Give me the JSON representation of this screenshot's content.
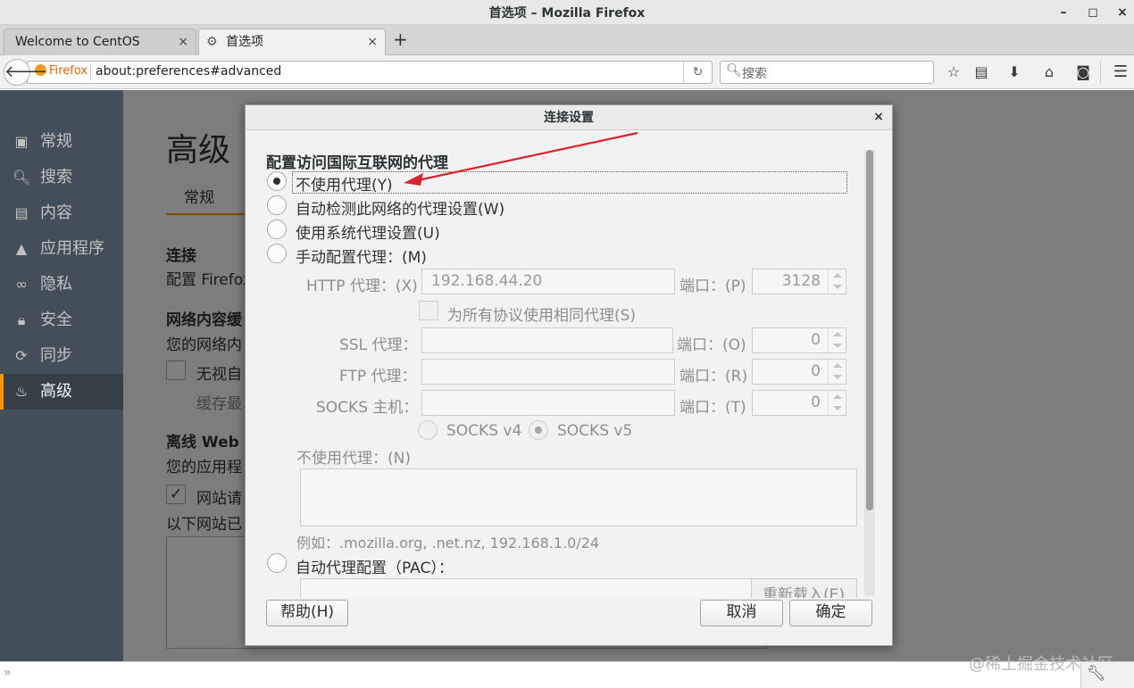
{
  "window": {
    "title": "首选项 – Mozilla Firefox",
    "minimize": "–",
    "maximize": "◻",
    "close": "×"
  },
  "tabs": [
    {
      "label": "Welcome to CentOS",
      "close": "×"
    },
    {
      "label": "首选项",
      "close": "×"
    }
  ],
  "new_tab": "+",
  "navbar": {
    "identity_label": "Firefox",
    "url": "about:preferences#advanced",
    "search_placeholder": "搜索"
  },
  "sidebar": {
    "items": [
      {
        "label": "常规",
        "icon": "general-icon"
      },
      {
        "label": "搜索",
        "icon": "search-icon"
      },
      {
        "label": "内容",
        "icon": "content-icon"
      },
      {
        "label": "应用程序",
        "icon": "applications-icon"
      },
      {
        "label": "隐私",
        "icon": "privacy-icon"
      },
      {
        "label": "安全",
        "icon": "security-icon"
      },
      {
        "label": "同步",
        "icon": "sync-icon"
      },
      {
        "label": "高级",
        "icon": "advanced-icon"
      }
    ],
    "selected": "高级"
  },
  "page": {
    "heading": "高级",
    "subtab": "常规",
    "connection_heading": "连接",
    "connection_desc": "配置 Firefox",
    "cache_heading": "网络内容缓",
    "cache_desc": "您的网络内",
    "cache_override": "无视自",
    "cache_limit": "缓存最",
    "offline_heading": "离线 Web",
    "offline_desc": "您的应用程",
    "offline_warn": "网站请",
    "offline_list": "以下网站已"
  },
  "dialog": {
    "title": "连接设置",
    "section_title": "配置访问国际互联网的代理",
    "options": {
      "no_proxy": "不使用代理(Y)",
      "auto_detect": "自动检测此网络的代理设置(W)",
      "system": "使用系统代理设置(U)",
      "manual": "手动配置代理：(M)",
      "auto_config": "自动代理配置（PAC）："
    },
    "selected_option": "no_proxy",
    "http_label": "HTTP 代理：(X)",
    "http_value": "192.168.44.20",
    "http_port_label": "端口：(P)",
    "http_port": "3128",
    "share_label": "为所有协议使用相同代理(S)",
    "ssl_label": "SSL 代理：",
    "ssl_port_label": "端口：(O)",
    "ssl_port": "0",
    "ftp_label": "FTP 代理：",
    "ftp_port_label": "端口：(R)",
    "ftp_port": "0",
    "socks_label": "SOCKS 主机：",
    "socks_port_label": "端口：(T)",
    "socks_port": "0",
    "socks_v4": "SOCKS v4",
    "socks_v5": "SOCKS v5",
    "socks_selected": "v5",
    "no_proxy_for_label": "不使用代理：(N)",
    "no_proxy_for_value": "",
    "example": "例如：.mozilla.org, .net.nz, 192.168.1.0/24",
    "reload_button": "重新载入(E)",
    "help_button": "帮助(H)",
    "cancel_button": "取消",
    "ok_button": "确定",
    "close": "×"
  },
  "watermark": "@稀土掘金技术社区",
  "annotation_color": "#d9232d"
}
